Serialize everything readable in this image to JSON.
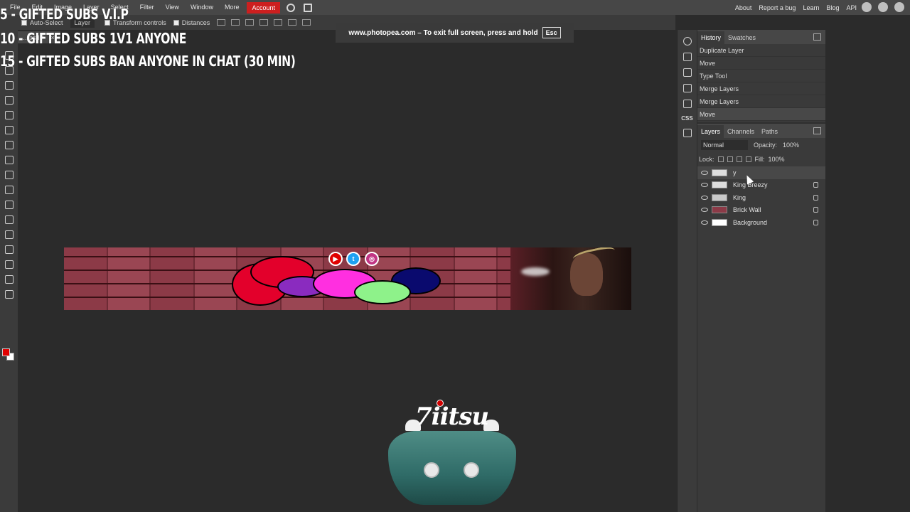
{
  "menubar": {
    "items": [
      "File",
      "Edit",
      "Image",
      "Layer",
      "Select",
      "Filter",
      "View",
      "Window",
      "More"
    ],
    "account": "Account",
    "links": [
      "About",
      "Report a bug",
      "Learn",
      "Blog",
      "API"
    ]
  },
  "options": {
    "auto_select": "Auto-Select",
    "layer_select": "Layer",
    "transform_controls": "Transform controls",
    "distances": "Distances"
  },
  "file_tab": {
    "name": "…psd *",
    "close": "×"
  },
  "overlay": {
    "line1": "5 - GIFTED SUBS V.I.P",
    "line2": "10 - GIFTED SUBS 1V1 ANYONE",
    "line3": "15 - GIFTED SUBS BAN ANYONE IN CHAT (30 MIN)"
  },
  "fullscreen_notice": {
    "text": "www.photopea.com – To exit full screen, press and hold",
    "key": "Esc"
  },
  "logo": {
    "name": "7iitsu"
  },
  "history": {
    "tabs": [
      "History",
      "Swatches"
    ],
    "items": [
      "Duplicate Layer",
      "Move",
      "Type Tool",
      "Merge Layers",
      "Merge Layers",
      "Move"
    ]
  },
  "layers": {
    "tabs": [
      "Layers",
      "Channels",
      "Paths"
    ],
    "blend_mode": "Normal",
    "opacity_label": "Opacity:",
    "opacity_value": "100%",
    "lock_label": "Lock:",
    "fill_label": "Fill:",
    "fill_value": "100%",
    "items": [
      {
        "name": "y"
      },
      {
        "name": "King Breezy"
      },
      {
        "name": "King"
      },
      {
        "name": "Brick Wall"
      },
      {
        "name": "Background"
      }
    ]
  },
  "icons": {
    "search": "search-icon",
    "fullscreen": "fullscreen-icon",
    "reddit": "reddit-icon",
    "twitter": "twitter-icon",
    "facebook": "facebook-icon"
  }
}
